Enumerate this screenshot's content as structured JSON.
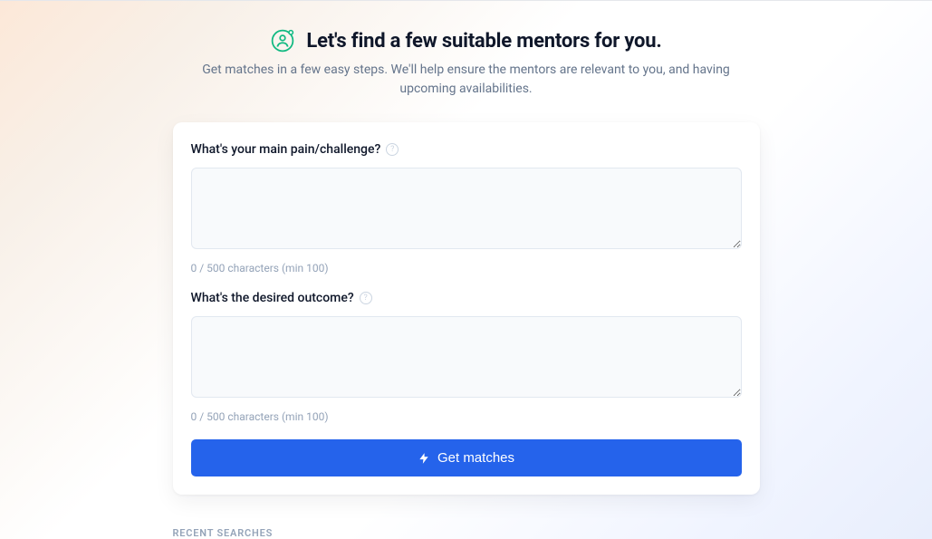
{
  "header": {
    "title": "Let's find a few suitable mentors for you.",
    "subtitle": "Get matches in a few easy steps. We'll help ensure the mentors are relevant to you, and having upcoming availabilities."
  },
  "form": {
    "field1": {
      "label": "What's your main pain/challenge?",
      "value": "",
      "counter": "0 / 500 characters (min 100)"
    },
    "field2": {
      "label": "What's the desired outcome?",
      "value": "",
      "counter": "0 / 500 characters (min 100)"
    },
    "submit_label": "Get matches"
  },
  "recent_section_label": "RECENT SEARCHES"
}
